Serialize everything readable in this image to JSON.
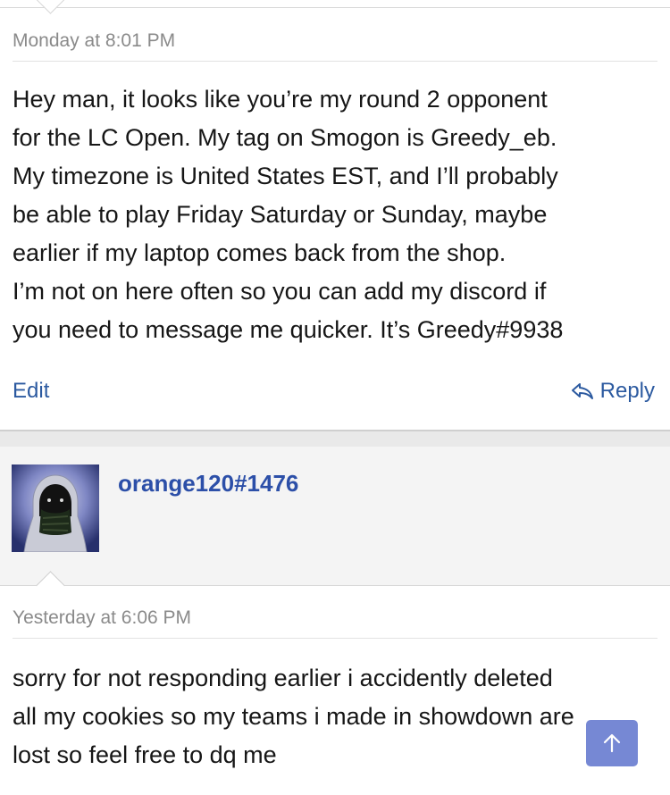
{
  "post1": {
    "timestamp": "Monday at 8:01 PM",
    "body": "Hey man, it looks like you’re my round 2 opponent\nfor the LC Open. My tag on Smogon is Greedy_eb.\nMy timezone is United States EST, and I’ll probably\nbe able to play Friday Saturday or Sunday, maybe\nearlier if my laptop comes back from the shop.\nI’m not on here often so you can add my discord if\nyou need to message me quicker. It’s Greedy#9938",
    "edit_label": "Edit",
    "reply_label": "Reply"
  },
  "user": {
    "username": "orange120#1476"
  },
  "post2": {
    "timestamp": "Yesterday at 6:06 PM",
    "body": "sorry for not responding earlier i accidently deleted\nall my cookies so my teams i made in showdown are\nlost so feel free to dq me"
  },
  "icons": {
    "reply": "reply-arrow-icon",
    "scroll_top": "arrow-up-icon"
  },
  "colors": {
    "link": "#2c5aa0",
    "username": "#2c4fa8",
    "scroll_button": "#6f82d2"
  }
}
